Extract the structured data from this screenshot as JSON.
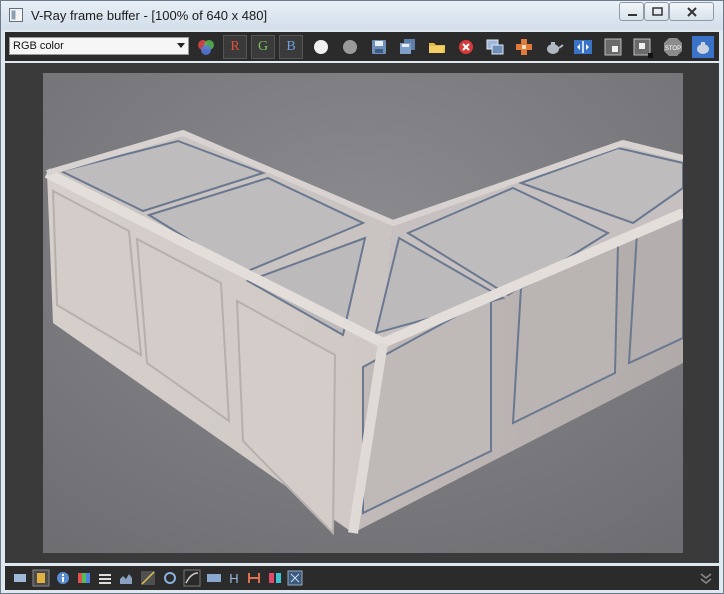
{
  "window": {
    "title": "V-Ray frame buffer - [100% of 640 x 480]"
  },
  "toolbar": {
    "channel_select": "RGB color",
    "channels": [
      {
        "label": "R",
        "color": "#e0503c"
      },
      {
        "label": "G",
        "color": "#7fbf5a"
      },
      {
        "label": "B",
        "color": "#6f9fe0"
      }
    ],
    "tools": [
      "mono-white-icon",
      "mono-gray-icon",
      "save-icon",
      "save-all-icon",
      "open-icon",
      "clear-icon",
      "duplicate-icon",
      "track-mouse-icon",
      "render-teapot-icon",
      "compare-icon",
      "region-icon",
      "region-render-icon",
      "stop-icon",
      "render-last-icon"
    ]
  },
  "statusbar": {
    "tools": [
      "display-icon",
      "color-correction-icon",
      "info-icon",
      "lut-icon",
      "levels-icon",
      "histogram-icon",
      "curve-icon",
      "exposure-icon",
      "hsl-icon",
      "white-balance-icon",
      "fit-icon",
      "h-icon",
      "pixel-aspect-icon",
      "channels-icon",
      "stamp-icon"
    ],
    "h_label": "H"
  }
}
